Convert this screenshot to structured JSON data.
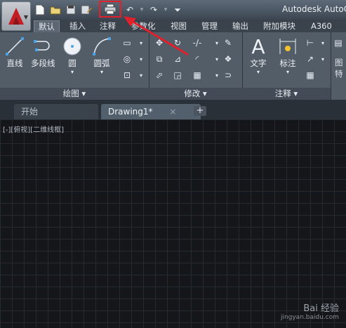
{
  "window": {
    "title": "Autodesk AutoC"
  },
  "qat": {
    "icons": [
      "new-icon",
      "open-icon",
      "save-icon",
      "saveas-icon",
      "print-icon",
      "undo-icon",
      "redo-icon",
      "customize-icon"
    ]
  },
  "tabs": [
    {
      "label": "默认",
      "active": true
    },
    {
      "label": "插入"
    },
    {
      "label": "注释"
    },
    {
      "label": "参数化"
    },
    {
      "label": "视图"
    },
    {
      "label": "管理"
    },
    {
      "label": "输出"
    },
    {
      "label": "附加模块"
    },
    {
      "label": "A360"
    }
  ],
  "ribbon": {
    "draw": {
      "label": "绘图 ▾",
      "tools": [
        "直线",
        "多段线",
        "圆",
        "圆弧"
      ]
    },
    "modify": {
      "label": "修改 ▾"
    },
    "annotation": {
      "label": "注释 ▾",
      "tools": [
        "文字",
        "标注"
      ]
    },
    "partial": {
      "tools": [
        "图",
        "特"
      ]
    }
  },
  "file_tabs": [
    {
      "label": "开始"
    },
    {
      "label": "Drawing1*",
      "active": true,
      "close": "×"
    }
  ],
  "file_tabs_add": "+",
  "canvas": {
    "viewport_label": "[-][俯视][二维线框]"
  },
  "watermark": {
    "main": "Bai 经验",
    "sub": "jingyan.baidu.com"
  },
  "colors": {
    "highlight": "#e0202a",
    "arrow": "#e0202a",
    "accent": "#c41e24"
  }
}
